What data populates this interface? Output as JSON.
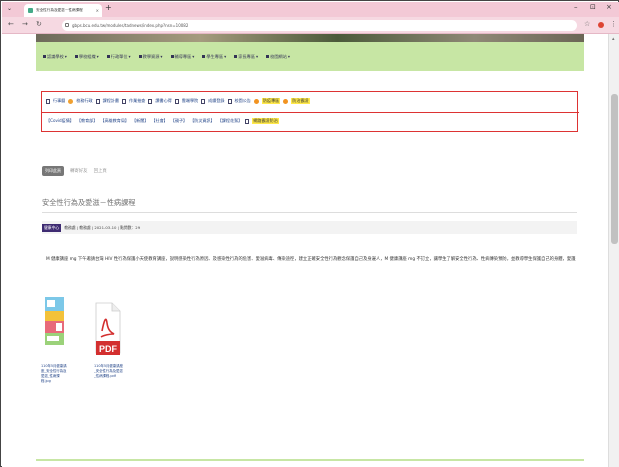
{
  "browser": {
    "tab_title": "安全性行為及愛滋－性病課程",
    "tab_close": "×",
    "new_tab": "+",
    "url": "gbps.bcu.edu.tw/modules/tadnews/index.php?nsn=10082",
    "minimize": "–",
    "maximize": "⊡",
    "close": "×"
  },
  "menu": [
    {
      "label": "認識學校"
    },
    {
      "label": "學校組織"
    },
    {
      "label": "行政單位"
    },
    {
      "label": "教學資源"
    },
    {
      "label": "輔導專區"
    },
    {
      "label": "學生專區"
    },
    {
      "label": "家長專區"
    },
    {
      "label": "校園網站"
    }
  ],
  "links_row1": [
    {
      "label": "行事曆",
      "icon": "doc-icon"
    },
    {
      "label": "校務行政",
      "icon": "pin-icon"
    },
    {
      "label": "課程計畫",
      "icon": "doc-icon"
    },
    {
      "label": "作業抽查",
      "icon": "doc-icon"
    },
    {
      "label": "讀書心得",
      "icon": "doc-icon"
    },
    {
      "label": "雲端學院",
      "icon": "doc-icon"
    },
    {
      "label": "成績登錄",
      "icon": "doc-icon"
    },
    {
      "label": "校園公告",
      "icon": "doc-icon"
    },
    {
      "label": "防疫專區",
      "icon": "ball-icon",
      "highlight": true
    },
    {
      "label": "防治霸凌",
      "icon": "ball-icon",
      "highlight": true
    }
  ],
  "links_row2": [
    {
      "label": "【Covid疫情】"
    },
    {
      "label": "【教育部】"
    },
    {
      "label": "【高雄教育局】"
    },
    {
      "label": "【新聞】"
    },
    {
      "label": "【社會】"
    },
    {
      "label": "【親子】"
    },
    {
      "label": "【防災資訊】"
    },
    {
      "label": "【課程花絮】"
    },
    {
      "label": "網路霸凌防治",
      "highlight": true
    }
  ],
  "actions": {
    "print": "列印此頁",
    "share": "轉寄好友",
    "back": "回上頁"
  },
  "article": {
    "title": "安全性行為及愛滋－性病課程",
    "badge": "健康中心",
    "meta": "教務處 | 教務處 | 2021-03-10 | 點閱數：29",
    "body": "M 健康講座 mg 下午邀請台灣 HIV 性行為保護小天使教育講座，說明感染性行為原因、及感染性行為的危害、愛滋病毒、傳染途徑，建立正確安全性行為觀念保護自己及身邊人，M 健康講座 mg 不訂立，讓學生了解安全性行為、性病傳染預防，並教導學生保護自己的身體，愛護身體！"
  },
  "attachments": [
    {
      "caption": "110年5月健康講座_安全性行為及愛滋_性病課程.jpg",
      "icon": "image-thumbnail-icon"
    },
    {
      "caption": "110年5月健康講座_安全性行為及愛滋_性病課程.pdf",
      "icon": "pdf-icon"
    }
  ],
  "colors": {
    "tabstrip": "#f3c9d6",
    "menubar": "#c7e6a4",
    "linkbox_border": "#dd3333",
    "highlight": "#ffe94a",
    "badge": "#3e2b72"
  }
}
